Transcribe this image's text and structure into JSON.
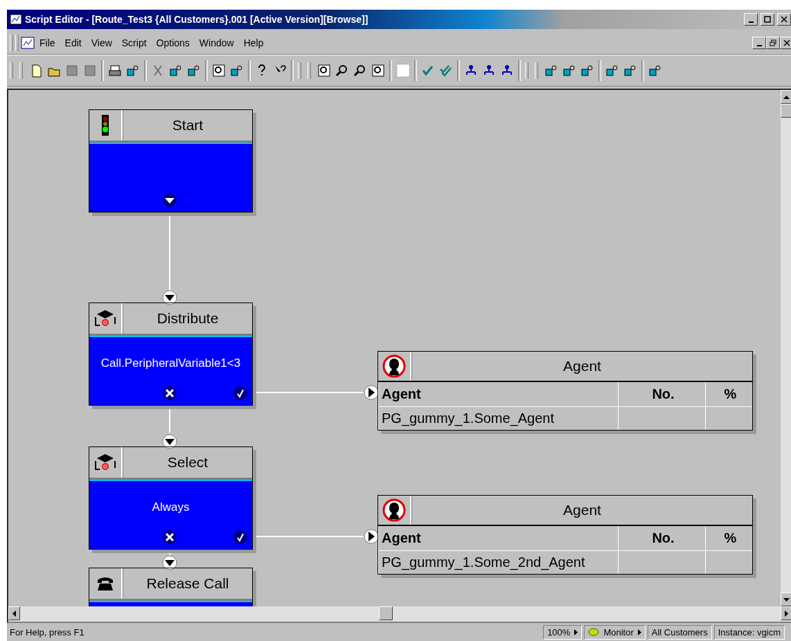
{
  "window": {
    "title": "Script Editor - [Route_Test3 {All Customers}.001 [Active Version][Browse]]"
  },
  "menu": [
    "File",
    "Edit",
    "View",
    "Script",
    "Options",
    "Window",
    "Help"
  ],
  "nodes": [
    {
      "kind": "start",
      "title": "Start"
    },
    {
      "kind": "distribute",
      "title": "Distribute",
      "body": "Call.PeripheralVariable1<3"
    },
    {
      "kind": "select",
      "title": "Select",
      "body": "Always"
    },
    {
      "kind": "release",
      "title": "Release Call"
    }
  ],
  "agent_tables": [
    {
      "title": "Agent",
      "columns": [
        "Agent",
        "No.",
        "%"
      ],
      "rows": [
        [
          "PG_gummy_1.Some_Agent",
          "",
          ""
        ]
      ]
    },
    {
      "title": "Agent",
      "columns": [
        "Agent",
        "No.",
        "%"
      ],
      "rows": [
        [
          "PG_gummy_1.Some_2nd_Agent",
          "",
          ""
        ]
      ]
    }
  ],
  "status_bar": {
    "help": "For Help, press F1",
    "zoom": "100%",
    "mode": "Monitor",
    "scope": "All Customers",
    "instance": "Instance: vgicm"
  }
}
